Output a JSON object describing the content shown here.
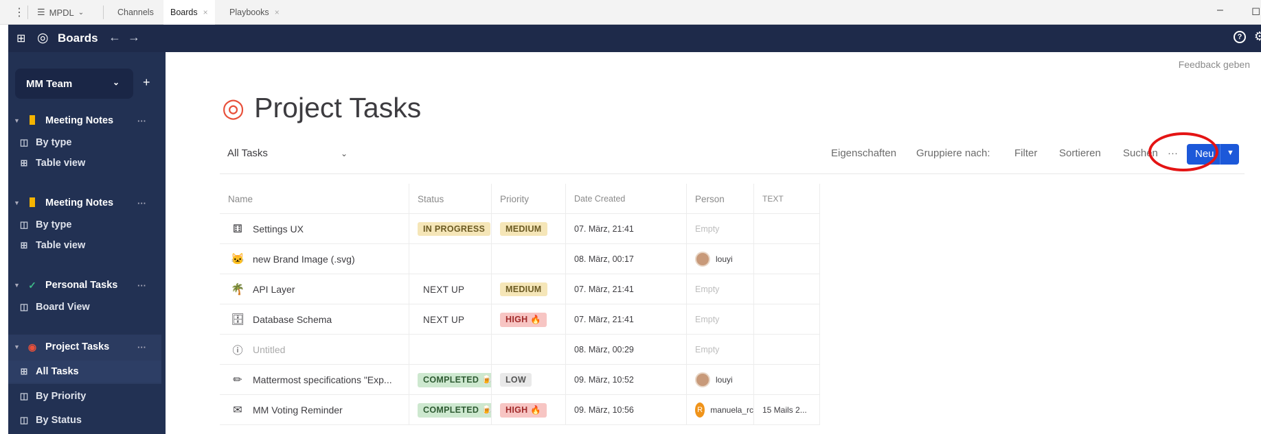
{
  "topbar": {
    "server_name": "MPDL",
    "tabs": [
      {
        "label": "Channels"
      },
      {
        "label": "Boards"
      },
      {
        "label": "Playbooks"
      }
    ]
  },
  "appbar": {
    "title": "Boards",
    "back_arrow": "←",
    "forward_arrow": "→",
    "help": "?"
  },
  "sidebar": {
    "team": "MM Team",
    "add": "+",
    "sections": [
      {
        "label": "Meeting Notes",
        "icon": "folder-yellow-icon",
        "items": [
          "By type",
          "Table view"
        ]
      },
      {
        "label": "Meeting Notes",
        "icon": "folder-yellow-icon",
        "items": [
          "By type",
          "Table view"
        ]
      },
      {
        "label": "Personal Tasks",
        "icon": "check-icon",
        "items": [
          "Board View"
        ]
      },
      {
        "label": "Project Tasks",
        "icon": "target-icon",
        "items": [
          "All Tasks",
          "By Priority",
          "By Status"
        ]
      }
    ],
    "more": "···"
  },
  "main": {
    "feedback": "Feedback geben",
    "title": "Project Tasks",
    "view_selector": "All Tasks",
    "tools": {
      "properties": "Eigenschaften",
      "group_by": "Gruppiere nach:",
      "filter": "Filter",
      "sort": "Sortieren",
      "search": "Suchen",
      "more": "···",
      "new": "Neu"
    }
  },
  "table": {
    "headers": [
      "Name",
      "Status",
      "Priority",
      "Date Created",
      "Person",
      "TEXT"
    ],
    "rows": [
      {
        "icon": "grid-dice-icon",
        "name": "Settings UX",
        "status": "IN PROGRESS",
        "priority": "MEDIUM",
        "date": "07. März, 21:41",
        "person": "Empty",
        "text": ""
      },
      {
        "icon": "cat-face-icon",
        "name": "new Brand Image (.svg)",
        "status": "",
        "priority": "",
        "date": "08. März, 00:17",
        "person": "louyi",
        "text": ""
      },
      {
        "icon": "palm-tree-icon",
        "name": "API Layer",
        "status": "NEXT UP",
        "priority": "MEDIUM",
        "date": "07. März, 21:41",
        "person": "Empty",
        "text": ""
      },
      {
        "icon": "database-icon",
        "name": "Database Schema",
        "status": "NEXT UP",
        "priority": "HIGH 🔥",
        "date": "07. März, 21:41",
        "person": "Empty",
        "text": ""
      },
      {
        "icon": "untitled-info-icon",
        "name": "Untitled",
        "status": "",
        "priority": "",
        "date": "08. März, 00:29",
        "person": "Empty",
        "text": ""
      },
      {
        "icon": "pencil-icon",
        "name": "Mattermost specifications \"Exp...",
        "status": "COMPLETED 🍺",
        "priority": "LOW",
        "date": "09. März, 10:52",
        "person": "louyi",
        "text": ""
      },
      {
        "icon": "mail-card-icon",
        "name": "MM Voting Reminder",
        "status": "COMPLETED 🍺",
        "priority": "HIGH 🔥",
        "date": "09. März, 10:56",
        "person": "manuela_rc",
        "avatar_letter": "R",
        "text": "15 Mails 2..."
      }
    ]
  }
}
